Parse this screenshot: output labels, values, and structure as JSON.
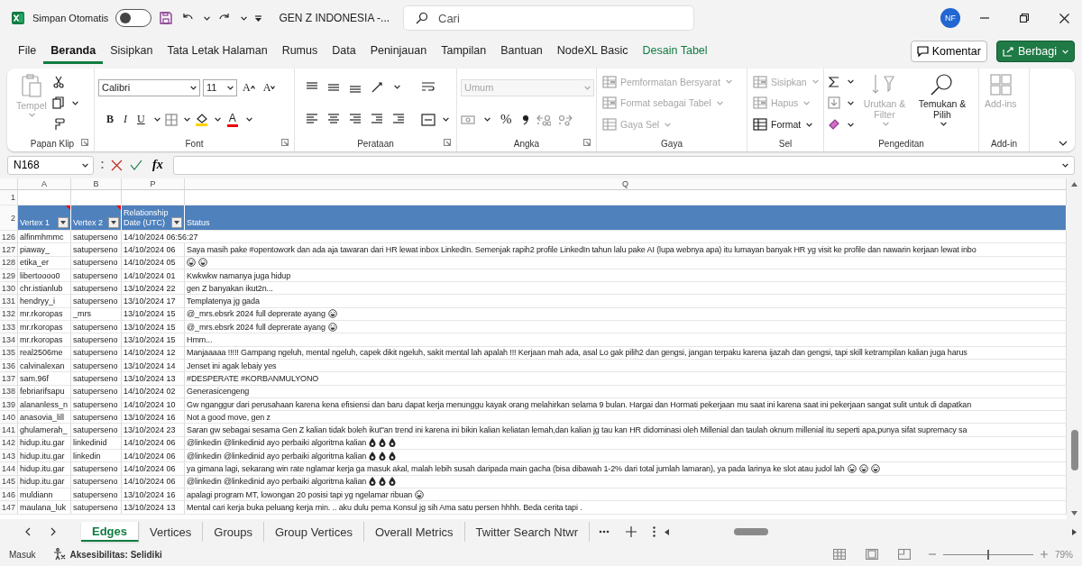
{
  "title_bar": {
    "autosave_label": "Simpan Otomatis",
    "autosave_on": false,
    "document_title": "GEN Z INDONESIA  -...",
    "search": {
      "placeholder": "Cari"
    },
    "account_initials": "NF"
  },
  "menu": {
    "tabs": [
      {
        "label": "File",
        "kind": "tab",
        "selected": false
      },
      {
        "label": "Beranda",
        "kind": "tab",
        "selected": true
      },
      {
        "label": "Sisipkan",
        "kind": "tab",
        "selected": false
      },
      {
        "label": "Tata Letak Halaman",
        "kind": "tab",
        "selected": false
      },
      {
        "label": "Rumus",
        "kind": "tab",
        "selected": false
      },
      {
        "label": "Data",
        "kind": "tab",
        "selected": false
      },
      {
        "label": "Peninjauan",
        "kind": "tab",
        "selected": false
      },
      {
        "label": "Tampilan",
        "kind": "tab",
        "selected": false
      },
      {
        "label": "Bantuan",
        "kind": "tab",
        "selected": false
      },
      {
        "label": "NodeXL Basic",
        "kind": "tab",
        "selected": false
      },
      {
        "label": "Desain Tabel",
        "kind": "contextual",
        "selected": false
      }
    ],
    "comment_button": "Komentar",
    "share_button": "Berbagi"
  },
  "ribbon": {
    "groups": [
      {
        "kind": "clipboard",
        "label": "Papan Klip",
        "launcher": true,
        "paste": {
          "label": "Tempel",
          "disabled": true
        }
      },
      {
        "kind": "font",
        "label": "Font",
        "launcher": true,
        "font_name": "Calibri",
        "font_size": "11",
        "size_buttons": [
          "A",
          "A"
        ],
        "style_buttons": [
          "B",
          "I",
          "U"
        ],
        "font_color_label": "A"
      },
      {
        "kind": "alignment",
        "label": "Perataan",
        "launcher": true
      },
      {
        "kind": "number",
        "label": "Angka",
        "launcher": true,
        "format": {
          "value": "Umum",
          "disabled": true
        },
        "percent_label": "%"
      },
      {
        "kind": "styles",
        "label": "Gaya",
        "launcher": false,
        "commands": [
          {
            "label": "Pemformatan Bersyarat",
            "disabled": true
          },
          {
            "label": "Format sebagai Tabel",
            "disabled": true
          },
          {
            "label": "Gaya Sel",
            "disabled": true
          }
        ]
      },
      {
        "kind": "cells",
        "label": "Sel",
        "launcher": false,
        "commands": [
          {
            "label": "Sisipkan",
            "disabled": true
          },
          {
            "label": "Hapus",
            "disabled": true
          },
          {
            "label": "Format",
            "disabled": false
          }
        ]
      },
      {
        "kind": "editing",
        "label": "Pengeditan",
        "launcher": false,
        "commands": [
          {
            "label": "Urutkan & Filter",
            "disabled": true
          },
          {
            "label": "Temukan & Pilih",
            "disabled": false
          }
        ]
      },
      {
        "kind": "addins",
        "label": "Add-in",
        "launcher": false,
        "commands": [
          {
            "label": "Add-ins",
            "disabled": true
          }
        ]
      }
    ]
  },
  "formula_bar": {
    "name_box": "N168",
    "function_label": "fx"
  },
  "sheet": {
    "columns": [
      "A",
      "B",
      "P",
      "Q"
    ],
    "empty_row": "1",
    "header_row": {
      "number": "2",
      "cells": [
        {
          "label": "Vertex 1",
          "filter": true,
          "comment": true
        },
        {
          "label": "Vertex 2",
          "filter": true,
          "comment": true
        },
        {
          "label": "Relationship Date (UTC)",
          "filter": true,
          "comment": false
        },
        {
          "label": "Status",
          "filter": false,
          "comment": false
        }
      ]
    },
    "rows": [
      {
        "number": "126",
        "vertex_1": "alfinmhmmc",
        "vertex_2": "satuperseno",
        "date": "14/10/2024 06:56:27"
      },
      {
        "number": "127",
        "vertex_1": "piaway_",
        "vertex_2": "satuperseno",
        "date": "14/10/2024 06",
        "status": "Saya masih pake #opentowork dan ada aja tawaran dari HR lewat inbox LinkedIn. Semenjak rapih2 profile LinkedIn tahun lalu pake AI (lupa webnya apa) itu lumayan banyak HR yg visit ke profile dan nawarin kerjaan lewat inbo"
      },
      {
        "number": "128",
        "vertex_1": "etika_er",
        "vertex_2": "satuperseno",
        "date": "14/10/2024 05",
        "icons": [
          {
            "kind": "face"
          },
          {
            "kind": "face"
          }
        ]
      },
      {
        "number": "129",
        "vertex_1": "libertoooo0",
        "vertex_2": "satuperseno",
        "date": "14/10/2024 01",
        "status": "Kwkwkw namanya juga hidup"
      },
      {
        "number": "130",
        "vertex_1": "chr.istianlub",
        "vertex_2": "satuperseno",
        "date": "13/10/2024 22",
        "status": "gen Z banyakan ikut2n..."
      },
      {
        "number": "131",
        "vertex_1": "hendryy_i",
        "vertex_2": "satuperseno",
        "date": "13/10/2024 17",
        "status": "Templatenya jg gada"
      },
      {
        "number": "132",
        "vertex_1": "mr.rkoropas",
        "vertex_2": "_mrs",
        "date": "13/10/2024 15",
        "status": "@_mrs.ebsrk 2024 full deprerate ayang",
        "icons": [
          {
            "kind": "face"
          }
        ]
      },
      {
        "number": "133",
        "vertex_1": "mr.rkoropas",
        "vertex_2": "satuperseno",
        "date": "13/10/2024 15",
        "status": "@_mrs.ebsrk 2024 full deprerate ayang",
        "icons": [
          {
            "kind": "face"
          }
        ]
      },
      {
        "number": "134",
        "vertex_1": "mr.rkoropas",
        "vertex_2": "satuperseno",
        "date": "13/10/2024 15",
        "status": "Hmm..."
      },
      {
        "number": "135",
        "vertex_1": "real2506me",
        "vertex_2": "satuperseno",
        "date": "14/10/2024 12",
        "status": "Manjaaaaa !!!!! Gampang ngeluh, mental ngeluh, capek dikit ngeluh, sakit mental lah apalah !!! Kerjaan mah ada, asal Lo gak pilih2 dan gengsi, jangan terpaku karena ijazah dan gengsi, tapi skill ketrampilan kalian juga harus"
      },
      {
        "number": "136",
        "vertex_1": "calvinalexan",
        "vertex_2": "satuperseno",
        "date": "13/10/2024 14",
        "status": "Jenset ini agak lebaiy yes"
      },
      {
        "number": "137",
        "vertex_1": "sam.96f",
        "vertex_2": "satuperseno",
        "date": "13/10/2024 13",
        "status": "#DESPERATE #KORBANMULYONO"
      },
      {
        "number": "138",
        "vertex_1": "febriarifsapu",
        "vertex_2": "satuperseno",
        "date": "14/10/2024 02",
        "status": "Generasicengeng"
      },
      {
        "number": "139",
        "vertex_1": "alananless_n",
        "vertex_2": "satuperseno",
        "date": "14/10/2024 10",
        "status": "Gw nganggur dari perusahaan karena kena efisiensi dan baru dapat kerja menunggu kayak orang melahirkan selama 9 bulan. Hargai dan Hormati pekerjaan mu saat ini karena saat ini pekerjaan sangat sulit untuk di dapatkan"
      },
      {
        "number": "140",
        "vertex_1": "anasovia_lill",
        "vertex_2": "satuperseno",
        "date": "13/10/2024 16",
        "status": "Not a good move, gen z"
      },
      {
        "number": "141",
        "vertex_1": "ghulamerah_",
        "vertex_2": "satuperseno",
        "date": "13/10/2024 23",
        "status": "Saran gw sebagai sesama Gen Z kalian tidak boleh ikut\"an trend ini karena ini bikin kalian keliatan lemah,dan kalian jg tau kan HR didominasi oleh Millenial dan taulah oknum millenial itu seperti apa,punya sifat supremacy sa"
      },
      {
        "number": "142",
        "vertex_1": "hidup.itu.gar",
        "vertex_2": "linkedinid",
        "date": "14/10/2024 06",
        "status": "@linkedin @linkedinid ayo perbaiki algoritma kalian",
        "icons": [
          {
            "kind": "drop"
          },
          {
            "kind": "drop"
          },
          {
            "kind": "drop"
          }
        ]
      },
      {
        "number": "143",
        "vertex_1": "hidup.itu.gar",
        "vertex_2": "linkedin",
        "date": "14/10/2024 06",
        "status": "@linkedin @linkedinid ayo perbaiki algoritma kalian",
        "icons": [
          {
            "kind": "drop"
          },
          {
            "kind": "drop"
          },
          {
            "kind": "drop"
          }
        ]
      },
      {
        "number": "144",
        "vertex_1": "hidup.itu.gar",
        "vertex_2": "satuperseno",
        "date": "14/10/2024 06",
        "status": "ya gimana lagi, sekarang win rate nglamar kerja ga masuk akal, malah lebih susah daripada main gacha (bisa dibawah 1-2% dari total jumlah lamaran), ya pada larinya ke slot atau judol lah",
        "icons": [
          {
            "kind": "face"
          },
          {
            "kind": "face"
          },
          {
            "kind": "face"
          }
        ]
      },
      {
        "number": "145",
        "vertex_1": "hidup.itu.gar",
        "vertex_2": "satuperseno",
        "date": "14/10/2024 06",
        "status": "@linkedin @linkedinid ayo perbaiki algoritma kalian",
        "icons": [
          {
            "kind": "drop"
          },
          {
            "kind": "drop"
          },
          {
            "kind": "drop"
          }
        ]
      },
      {
        "number": "146",
        "vertex_1": "muldiann",
        "vertex_2": "satuperseno",
        "date": "13/10/2024 16",
        "status": "apalagi program MT, lowongan 20 posisi tapi yg ngelamar ribuan",
        "icons": [
          {
            "kind": "face"
          }
        ]
      },
      {
        "number": "147",
        "vertex_1": "maulana_luk",
        "vertex_2": "satuperseno",
        "date": "13/10/2024 13",
        "status": "Mental cari kerja buka peluang kerja min. .. aku dulu perna Konsul jg sih Ama satu persen hhhh. Beda cerita tapi ."
      }
    ]
  },
  "sheet_tabs": {
    "tabs": [
      {
        "label": "Edges",
        "selected": true
      },
      {
        "label": "Vertices",
        "selected": false
      },
      {
        "label": "Groups",
        "selected": false
      },
      {
        "label": "Group Vertices",
        "selected": false
      },
      {
        "label": "Overall Metrics",
        "selected": false
      },
      {
        "label": "Twitter Search Ntwr",
        "selected": false
      }
    ]
  },
  "status_bar": {
    "mode": "Masuk",
    "accessibility": "Aksesibilitas: Selidiki",
    "zoom": {
      "level": 0.5,
      "reading": "79%"
    }
  }
}
